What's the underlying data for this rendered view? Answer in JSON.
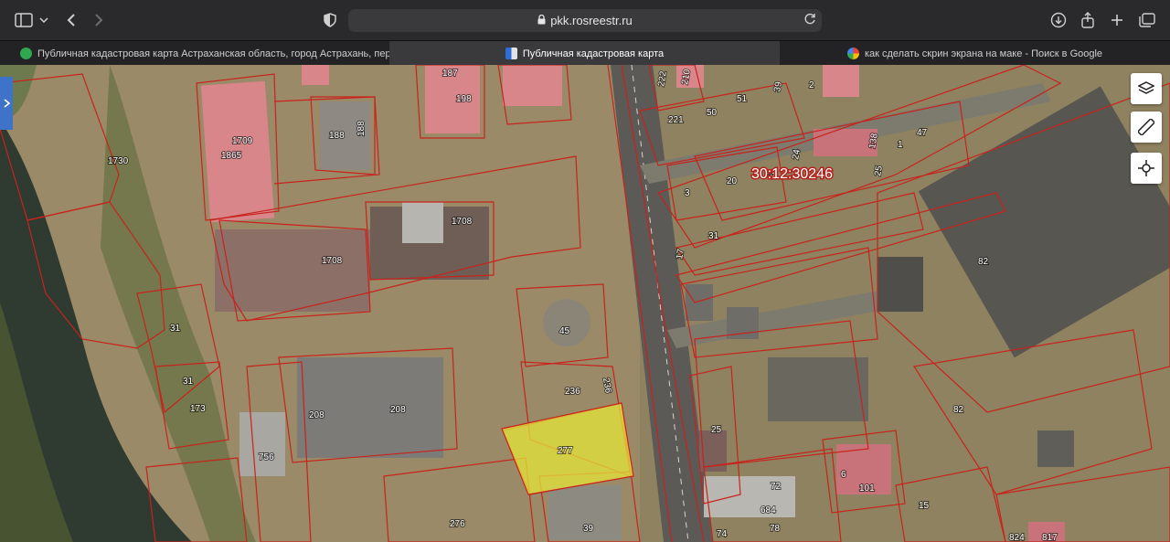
{
  "browser": {
    "address": "pkk.rosreestr.ru",
    "tabs": [
      {
        "label": "Публичная кадастровая карта Астраханская область, город Астрахань, пере..."
      },
      {
        "label": "Публичная кадастровая карта"
      },
      {
        "label": "как сделать скрин экрана на маке - Поиск в Google"
      }
    ]
  },
  "map": {
    "cadastral_quarter": "30:12:30246",
    "highlighted_parcel": "277",
    "parcel_labels": [
      "1730",
      "1709",
      "1865",
      "188",
      "188",
      "187",
      "198",
      "1708",
      "1708",
      "31",
      "31",
      "173",
      "208",
      "208",
      "756",
      "45",
      "236",
      "236",
      "277",
      "276",
      "39",
      "222",
      "210",
      "51",
      "221",
      "50",
      "39",
      "2",
      "1",
      "47",
      "23",
      "24",
      "138",
      "25",
      "20",
      "3",
      "31",
      "17",
      "82",
      "82",
      "25",
      "72",
      "684",
      "78",
      "6",
      "101",
      "15",
      "824",
      "817",
      "74"
    ],
    "controls": [
      "layers-icon",
      "ruler-icon",
      "locate-icon"
    ]
  },
  "colors": {
    "parcel_border": "#c8231c",
    "highlight": "#e6e63a"
  }
}
